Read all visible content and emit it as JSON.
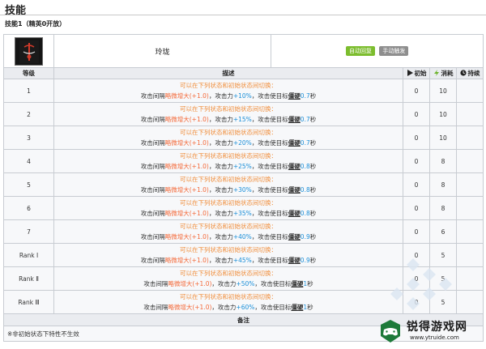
{
  "page": {
    "title": "技能",
    "subtitle": "技能1（精英0开放）"
  },
  "skill": {
    "name": "玲珑",
    "icon": "skill-emblem-icon",
    "badges": [
      "自动回复",
      "手动触发"
    ]
  },
  "columns": {
    "level": "等级",
    "desc": "描述",
    "init": "初始",
    "cost": "消耗",
    "dur": "持续"
  },
  "rows": [
    {
      "level": "1",
      "line1": "可以在下列状态和初始状态间切换：",
      "pre": "攻击间隔",
      "a": "略微增大",
      "b": "(+1.0)",
      "mid1": "，攻击力",
      "c": "+10%",
      "mid2": "，攻击使目标",
      "d": "僵硬",
      "e": "0.7",
      "tail": "秒",
      "init": "0",
      "cost": "10",
      "dur": ""
    },
    {
      "level": "2",
      "line1": "可以在下列状态和初始状态间切换：",
      "pre": "攻击间隔",
      "a": "略微增大",
      "b": "(+1.0)",
      "mid1": "，攻击力",
      "c": "+15%",
      "mid2": "，攻击使目标",
      "d": "僵硬",
      "e": "0.7",
      "tail": "秒",
      "init": "0",
      "cost": "10",
      "dur": ""
    },
    {
      "level": "3",
      "line1": "可以在下列状态和初始状态间切换：",
      "pre": "攻击间隔",
      "a": "略微增大",
      "b": "(+1.0)",
      "mid1": "，攻击力",
      "c": "+20%",
      "mid2": "，攻击使目标",
      "d": "僵硬",
      "e": "0.7",
      "tail": "秒",
      "init": "0",
      "cost": "10",
      "dur": ""
    },
    {
      "level": "4",
      "line1": "可以在下列状态和初始状态间切换：",
      "pre": "攻击间隔",
      "a": "略微增大",
      "b": "(+1.0)",
      "mid1": "，攻击力",
      "c": "+25%",
      "mid2": "，攻击使目标",
      "d": "僵硬",
      "e": "0.8",
      "tail": "秒",
      "init": "0",
      "cost": "8",
      "dur": ""
    },
    {
      "level": "5",
      "line1": "可以在下列状态和初始状态间切换：",
      "pre": "攻击间隔",
      "a": "略微增大",
      "b": "(+1.0)",
      "mid1": "，攻击力",
      "c": "+30%",
      "mid2": "，攻击使目标",
      "d": "僵硬",
      "e": "0.8",
      "tail": "秒",
      "init": "0",
      "cost": "8",
      "dur": ""
    },
    {
      "level": "6",
      "line1": "可以在下列状态和初始状态间切换：",
      "pre": "攻击间隔",
      "a": "略微增大",
      "b": "(+1.0)",
      "mid1": "，攻击力",
      "c": "+35%",
      "mid2": "，攻击使目标",
      "d": "僵硬",
      "e": "0.8",
      "tail": "秒",
      "init": "0",
      "cost": "8",
      "dur": ""
    },
    {
      "level": "7",
      "line1": "可以在下列状态和初始状态间切换：",
      "pre": "攻击间隔",
      "a": "略微增大",
      "b": "(+1.0)",
      "mid1": "，攻击力",
      "c": "+40%",
      "mid2": "，攻击使目标",
      "d": "僵硬",
      "e": "0.9",
      "tail": "秒",
      "init": "0",
      "cost": "6",
      "dur": ""
    },
    {
      "level": "Rank Ⅰ",
      "line1": "可以在下列状态和初始状态间切换：",
      "pre": "攻击间隔",
      "a": "略微增大",
      "b": "(+1.0)",
      "mid1": "，攻击力",
      "c": "+45%",
      "mid2": "，攻击使目标",
      "d": "僵硬",
      "e": "0.9",
      "tail": "秒",
      "init": "0",
      "cost": "5",
      "dur": ""
    },
    {
      "level": "Rank Ⅱ",
      "line1": "可以在下列状态和初始状态间切换：",
      "pre": "攻击间隔",
      "a": "略微增大",
      "b": "(+1.0)",
      "mid1": "，攻击力",
      "c": "+50%",
      "mid2": "，攻击使目标",
      "d": "僵硬",
      "e": "1",
      "tail": "秒",
      "init": "0",
      "cost": "5",
      "dur": ""
    },
    {
      "level": "Rank Ⅲ",
      "line1": "可以在下列状态和初始状态间切换：",
      "pre": "攻击间隔",
      "a": "略微增大",
      "b": "(+1.0)",
      "mid1": "，攻击力",
      "c": "+60%",
      "mid2": "，攻击使目标",
      "d": "僵硬",
      "e": "1",
      "tail": "秒",
      "init": "0",
      "cost": "5",
      "dur": ""
    }
  ],
  "note": {
    "header": "备注",
    "text": "※非初始状态下特性不生效"
  },
  "watermark": {
    "text": "锐得游戏网",
    "url": "www.ytruide.com"
  },
  "colors": {
    "accent_orange": "#f08d3a",
    "highlight_red": "#f46a3a",
    "value_blue": "#1b8fd8",
    "badge_green": "#7cbd2e",
    "badge_gray": "#8e8e8e",
    "header_bg": "#eaecf0"
  }
}
